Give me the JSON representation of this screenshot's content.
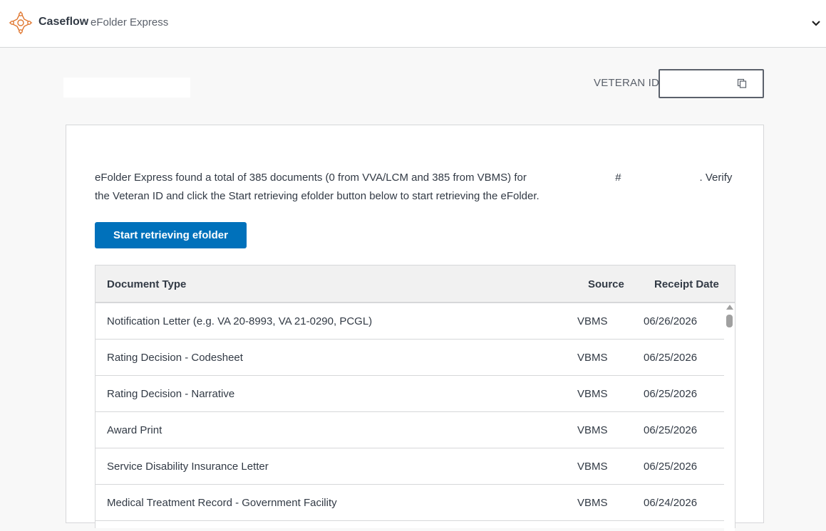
{
  "header": {
    "brand": "Caseflow",
    "product": "eFolder Express"
  },
  "veteran": {
    "label": "VETERAN ID",
    "value": ""
  },
  "intro": {
    "part1": "eFolder Express found a total of 385 documents (0 from VVA/LCM and 385 from VBMS) for",
    "hash": "#",
    "part2": ". Verify the Veteran ID and click the Start retrieving efolder button below to start retrieving the eFolder."
  },
  "actions": {
    "start_label": "Start retrieving efolder"
  },
  "table": {
    "headers": [
      "Document Type",
      "Source",
      "Receipt Date"
    ],
    "rows": [
      {
        "type": "Notification Letter (e.g. VA 20-8993, VA 21-0290, PCGL)",
        "source": "VBMS",
        "date": "06/26/2026"
      },
      {
        "type": "Rating Decision - Codesheet",
        "source": "VBMS",
        "date": "06/25/2026"
      },
      {
        "type": "Rating Decision - Narrative",
        "source": "VBMS",
        "date": "06/25/2026"
      },
      {
        "type": "Award Print",
        "source": "VBMS",
        "date": "06/25/2026"
      },
      {
        "type": "Service Disability Insurance Letter",
        "source": "VBMS",
        "date": "06/25/2026"
      },
      {
        "type": "Medical Treatment Record - Government Facility",
        "source": "VBMS",
        "date": "06/24/2026"
      }
    ]
  },
  "colors": {
    "primary": "#0071bb",
    "logo": "#e0762e"
  }
}
